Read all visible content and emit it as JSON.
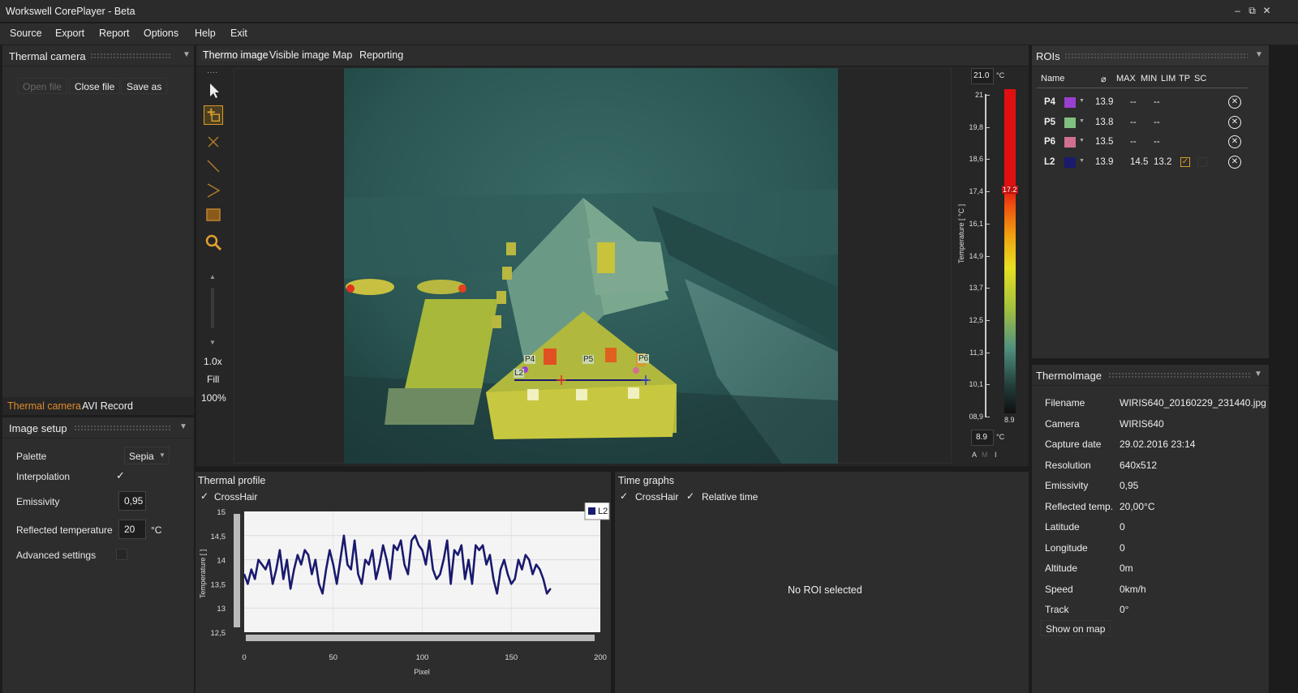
{
  "app": {
    "title": "Workswell CorePlayer - Beta"
  },
  "window_controls": {
    "minimize": "‒",
    "restore": "⧉",
    "close": "✕"
  },
  "menu": [
    "Source",
    "Export",
    "Report",
    "Options",
    "Help",
    "Exit"
  ],
  "left": {
    "thermal_camera_title": "Thermal camera",
    "open_file": "Open file",
    "close_file": "Close file",
    "save_as": "Save as",
    "tabs": [
      "Thermal camera",
      "AVI Record"
    ],
    "image_setup_title": "Image setup",
    "palette_label": "Palette",
    "palette_value": "Sepia",
    "interpolation_label": "Interpolation",
    "interpolation_check": "✓",
    "emissivity_label": "Emissivity",
    "emissivity_value": "0,95",
    "reflected_label": "Reflected temperature",
    "reflected_value": "20",
    "reflected_unit": "°C",
    "advanced_label": "Advanced settings"
  },
  "viewer": {
    "tabs": [
      "Thermo image",
      "Visible image",
      "Map",
      "Reporting"
    ],
    "zoom": "1.0x",
    "fill": "Fill",
    "percent": "100%",
    "roi_labels": [
      "P4",
      "P5",
      "P6",
      "L2"
    ],
    "scale": {
      "max_value": "21.0",
      "min_value": "8.9",
      "unit": "°C",
      "axis_label": "Temperature [ °C ]",
      "ticks": [
        "21",
        "19,8",
        "18,6",
        "17,4",
        "16,1",
        "14,9",
        "13,7",
        "12,5",
        "11,3",
        "10,1",
        "08,9"
      ],
      "marker_high": "17.2",
      "marker_low": "8.9",
      "modes": [
        "A",
        "M",
        "I"
      ]
    }
  },
  "rois": {
    "title": "ROIs",
    "headers": [
      "Name",
      "⌀",
      "MAX",
      "MIN",
      "LIM",
      "TP",
      "SC"
    ],
    "rows": [
      {
        "name": "P4",
        "color": "#9b3fd0",
        "avg": "13.9",
        "max": "--",
        "min": "--"
      },
      {
        "name": "P5",
        "color": "#7fbf7f",
        "avg": "13.8",
        "max": "--",
        "min": "--"
      },
      {
        "name": "P6",
        "color": "#d07090",
        "avg": "13.5",
        "max": "--",
        "min": "--"
      },
      {
        "name": "L2",
        "color": "#1a1a6e",
        "avg": "13.9",
        "max": "14.5",
        "min": "13.2"
      }
    ]
  },
  "thermoimage": {
    "title": "ThermoImage",
    "rows": [
      {
        "label": "Filename",
        "value": "WIRIS640_20160229_231440.jpg"
      },
      {
        "label": "Camera",
        "value": "WIRIS640"
      },
      {
        "label": "Capture date",
        "value": "29.02.2016 23:14"
      },
      {
        "label": "Resolution",
        "value": "640x512"
      },
      {
        "label": "Emissivity",
        "value": "0,95"
      },
      {
        "label": "Reflected temp.",
        "value": "20,00°C"
      },
      {
        "label": "Latitude",
        "value": "0"
      },
      {
        "label": "Longitude",
        "value": "0"
      },
      {
        "label": "Altitude",
        "value": "0m"
      },
      {
        "label": "Speed",
        "value": "0km/h"
      },
      {
        "label": "Track",
        "value": "0°"
      }
    ],
    "show_on_map": "Show on map"
  },
  "thermal_profile": {
    "title": "Thermal profile",
    "crosshair": "CrossHair",
    "check": "✓",
    "legend": "L2"
  },
  "time_graphs": {
    "title": "Time graphs",
    "crosshair": "CrossHair",
    "relative": "Relative time",
    "check": "✓",
    "empty": "No ROI selected"
  },
  "chart_data": {
    "type": "line",
    "xlabel": "Pixel",
    "ylabel": "Temperature [ ]",
    "xlim": [
      0,
      200
    ],
    "ylim": [
      12.5,
      15
    ],
    "xticks": [
      "0",
      "50",
      "100",
      "150",
      "200"
    ],
    "yticks": [
      "15",
      "14,5",
      "14",
      "13,5",
      "13",
      "12,5"
    ],
    "series": [
      {
        "name": "L2",
        "color": "#1a1a6e",
        "x": [
          0,
          2,
          4,
          6,
          8,
          10,
          12,
          14,
          16,
          18,
          20,
          22,
          24,
          26,
          28,
          30,
          32,
          34,
          36,
          38,
          40,
          42,
          44,
          46,
          48,
          50,
          52,
          54,
          56,
          58,
          60,
          62,
          64,
          66,
          68,
          70,
          72,
          74,
          76,
          78,
          80,
          82,
          84,
          86,
          88,
          90,
          92,
          94,
          96,
          98,
          100,
          102,
          104,
          106,
          108,
          110,
          112,
          114,
          116,
          118,
          120,
          122,
          124,
          126,
          128,
          130,
          132,
          134,
          136,
          138,
          140,
          142,
          144,
          146,
          148,
          150,
          152,
          154,
          156,
          158,
          160,
          162,
          164,
          166,
          168,
          170,
          172
        ],
        "y": [
          13.7,
          13.5,
          13.8,
          13.6,
          14.0,
          13.9,
          13.8,
          14.0,
          13.5,
          13.8,
          14.2,
          13.6,
          14.0,
          13.4,
          13.8,
          14.1,
          13.9,
          14.2,
          14.1,
          13.7,
          14.0,
          13.5,
          13.3,
          13.8,
          14.2,
          13.9,
          13.5,
          14.0,
          14.5,
          13.9,
          13.8,
          14.4,
          13.7,
          13.5,
          14.0,
          13.9,
          14.2,
          13.6,
          13.9,
          14.3,
          14.0,
          13.6,
          14.3,
          14.2,
          14.4,
          13.9,
          13.7,
          14.4,
          14.5,
          14.3,
          14.2,
          13.9,
          14.4,
          13.8,
          13.6,
          13.7,
          14.0,
          14.4,
          13.5,
          14.2,
          14.1,
          14.3,
          13.6,
          14.0,
          13.5,
          14.3,
          14.2,
          14.3,
          13.9,
          14.1,
          13.6,
          13.3,
          13.8,
          14.0,
          13.7,
          13.5,
          13.6,
          14.0,
          13.8,
          14.1,
          14.0,
          13.7,
          13.9,
          13.8,
          13.6,
          13.3,
          13.4
        ]
      }
    ]
  }
}
